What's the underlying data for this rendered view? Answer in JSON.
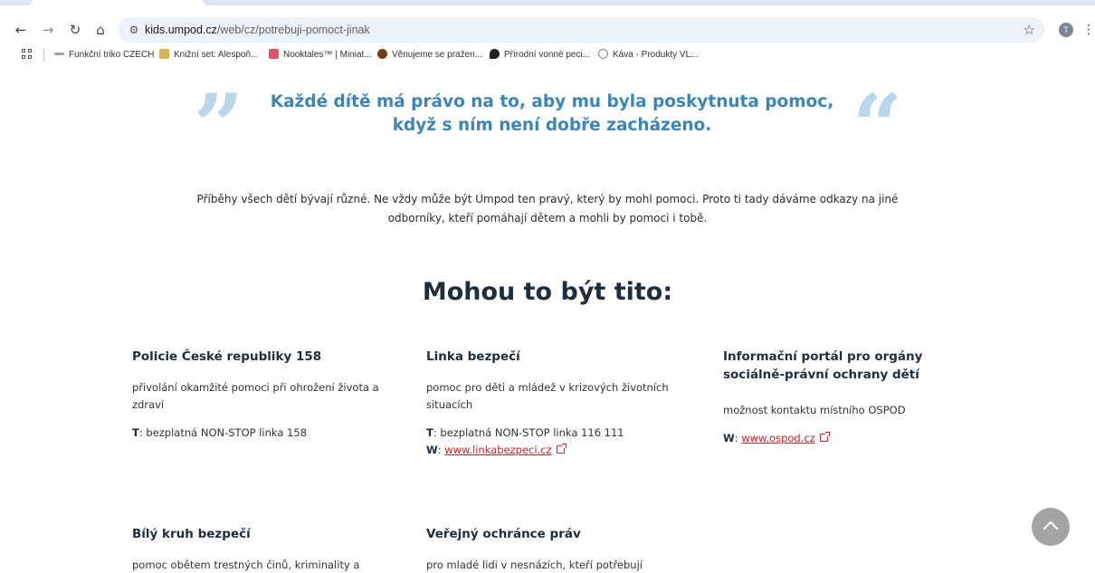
{
  "browser": {
    "url_host": "kids.umpod.cz",
    "url_path": "/web/cz/potrebuji-pomoct-jinak",
    "profile_initial": "T",
    "bookmarks": [
      {
        "label": "Funkční triko CZECH",
        "favicon_color": "#9aa4b0"
      },
      {
        "label": "Knižní set: Alespoň...",
        "favicon_color": "#d8b25a"
      },
      {
        "label": "Nooktales™ | Miniat...",
        "favicon_color": "#e8506a"
      },
      {
        "label": "Věnujeme se pražen...",
        "favicon_color": "#7a3b10"
      },
      {
        "label": "Přírodní vonné peci...",
        "favicon_color": "#222222"
      },
      {
        "label": "Káva - Produkty VL...",
        "favicon_color": "#8a8a8a"
      }
    ]
  },
  "quote": {
    "open_mark": "”",
    "close_mark": "“",
    "text": "Každé dítě má právo na to, aby mu byla poskytnuta pomoc, když s ním není dobře zacházeno."
  },
  "intro": "Příběhy všech dětí bývají různé. Ne vždy může být Umpod ten pravý, který by mohl pomoci. Proto ti tady dáváme odkazy na jiné odborníky, kteří pomáhají dětem a mohli by pomoci i tobě.",
  "section_title": "Mohou to být tito:",
  "cards": [
    {
      "title": "Policie České republiky 158",
      "desc": "přivolání okamžité pomoci při ohrožení života a zdraví",
      "phone_key": "T",
      "phone": ": bezplatná NON-STOP linka 158"
    },
    {
      "title": "Linka bezpečí",
      "desc": "pomoc pro děti a mládež v krizových životních situacích",
      "phone_key": "T",
      "phone": ": bezplatná NON-STOP linka 116 111",
      "web_key": "W",
      "web_sep": ": ",
      "web": "www.linkabezpeci.cz"
    },
    {
      "title": "Informační portál pro orgány sociálně-právní ochrany dětí",
      "desc": "možnost kontaktu místního OSPOD",
      "web_key": "W",
      "web_sep": ": ",
      "web": "www.ospod.cz"
    },
    {
      "title": "Bílý kruh bezpečí",
      "desc": "pomoc obětem trestných činů, kriminality a"
    },
    {
      "title": "Veřejný ochránce práv",
      "desc": "pro mladé lidi v nesnázích, kteří potřebují"
    }
  ],
  "colors": {
    "accent_blue": "#3a85bb",
    "quote_mark": "#b9d6ea",
    "link_red": "#d0202a",
    "heading": "#1f2d3d"
  },
  "icons": [
    "back-arrow-icon",
    "forward-arrow-icon",
    "reload-icon",
    "home-icon",
    "site-settings-icon",
    "bookmark-star-icon",
    "kebab-menu-icon",
    "apps-grid-icon",
    "external-link-icon",
    "chevron-up-icon"
  ]
}
